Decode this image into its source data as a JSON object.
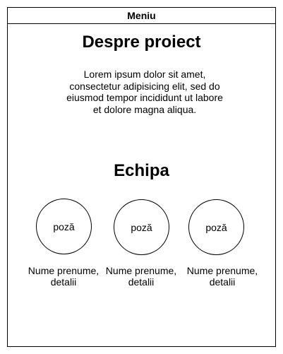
{
  "menu": {
    "label": "Meniu"
  },
  "about": {
    "title": "Despre proiect",
    "text": "Lorem ipsum dolor sit amet, consectetur adipisicing elit, sed do eiusmod tempor incididunt ut labore et dolore magna aliqua."
  },
  "team": {
    "title": "Echipa",
    "members": [
      {
        "photo_label": "poză",
        "caption_line1": "Nume prenume,",
        "caption_line2": "detalii"
      },
      {
        "photo_label": "poză",
        "caption_line1": "Nume prenume,",
        "caption_line2": "detalii"
      },
      {
        "photo_label": "poză",
        "caption_line1": "Nume prenume,",
        "caption_line2": "detalii"
      }
    ]
  }
}
